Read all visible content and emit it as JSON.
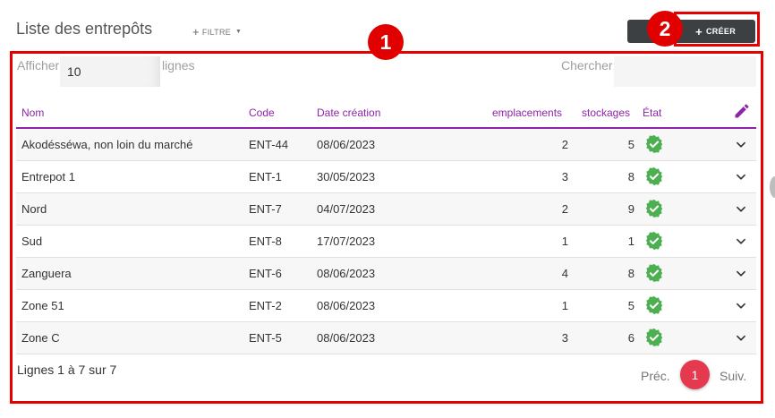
{
  "header": {
    "title": "Liste des entrepôts",
    "filter_label": "FILTRE",
    "create_label": "CRÉER"
  },
  "annotations": {
    "badge1": "1",
    "badge2": "2"
  },
  "controls": {
    "show_label": "Afficher",
    "show_value": "10",
    "show_suffix": "lignes",
    "search_label": "Chercher:",
    "search_value": ""
  },
  "table": {
    "headers": {
      "nom": "Nom",
      "code": "Code",
      "date": "Date création",
      "emplacements": "emplacements",
      "stockages": "stockages",
      "etat": "État"
    },
    "rows": [
      {
        "nom": "Akodésséwa, non loin du marché",
        "code": "ENT-44",
        "date": "08/06/2023",
        "emplacements": "2",
        "stockages": "5"
      },
      {
        "nom": "Entrepot 1",
        "code": "ENT-1",
        "date": "30/05/2023",
        "emplacements": "3",
        "stockages": "8"
      },
      {
        "nom": "Nord",
        "code": "ENT-7",
        "date": "04/07/2023",
        "emplacements": "2",
        "stockages": "9"
      },
      {
        "nom": "Sud",
        "code": "ENT-8",
        "date": "17/07/2023",
        "emplacements": "1",
        "stockages": "1"
      },
      {
        "nom": "Zanguera",
        "code": "ENT-6",
        "date": "08/06/2023",
        "emplacements": "4",
        "stockages": "8"
      },
      {
        "nom": "Zone 51",
        "code": "ENT-2",
        "date": "08/06/2023",
        "emplacements": "1",
        "stockages": "5"
      },
      {
        "nom": "Zone C",
        "code": "ENT-5",
        "date": "08/06/2023",
        "emplacements": "3",
        "stockages": "6"
      }
    ]
  },
  "footer": {
    "info": "Lignes 1 à 7 sur 7",
    "prev": "Préc.",
    "page": "1",
    "next": "Suiv."
  },
  "colors": {
    "accent": "#8e24aa",
    "create_button": "#3c4043",
    "annotation_red": "#e60000",
    "status_green": "#4caf50",
    "page_active": "#e53950"
  },
  "icons": {
    "filter": "plus-icon",
    "create": "plus-icon",
    "edit": "pencil-icon",
    "state": "verified-check-icon",
    "expand": "chevron-down-icon"
  }
}
